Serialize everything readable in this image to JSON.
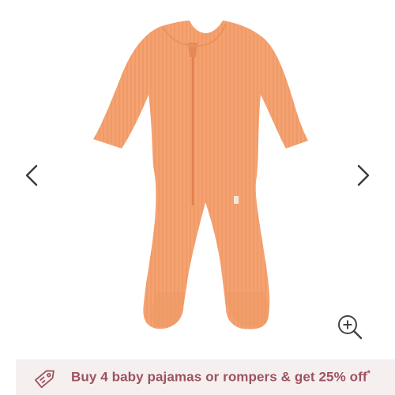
{
  "gallery": {
    "product": {
      "alt": "Orange ribbed zip-up footed sleepsuit",
      "color": "#f5a271"
    },
    "prev_icon": "chevron-left-icon",
    "next_icon": "chevron-right-icon",
    "zoom_icon": "zoom-in-icon"
  },
  "promo": {
    "icon": "price-tag-icon",
    "text": "Buy 4 baby pajamas or rompers & get 25% off",
    "asterisk": "*",
    "color": "#9c5360",
    "background": "#f6efef"
  }
}
